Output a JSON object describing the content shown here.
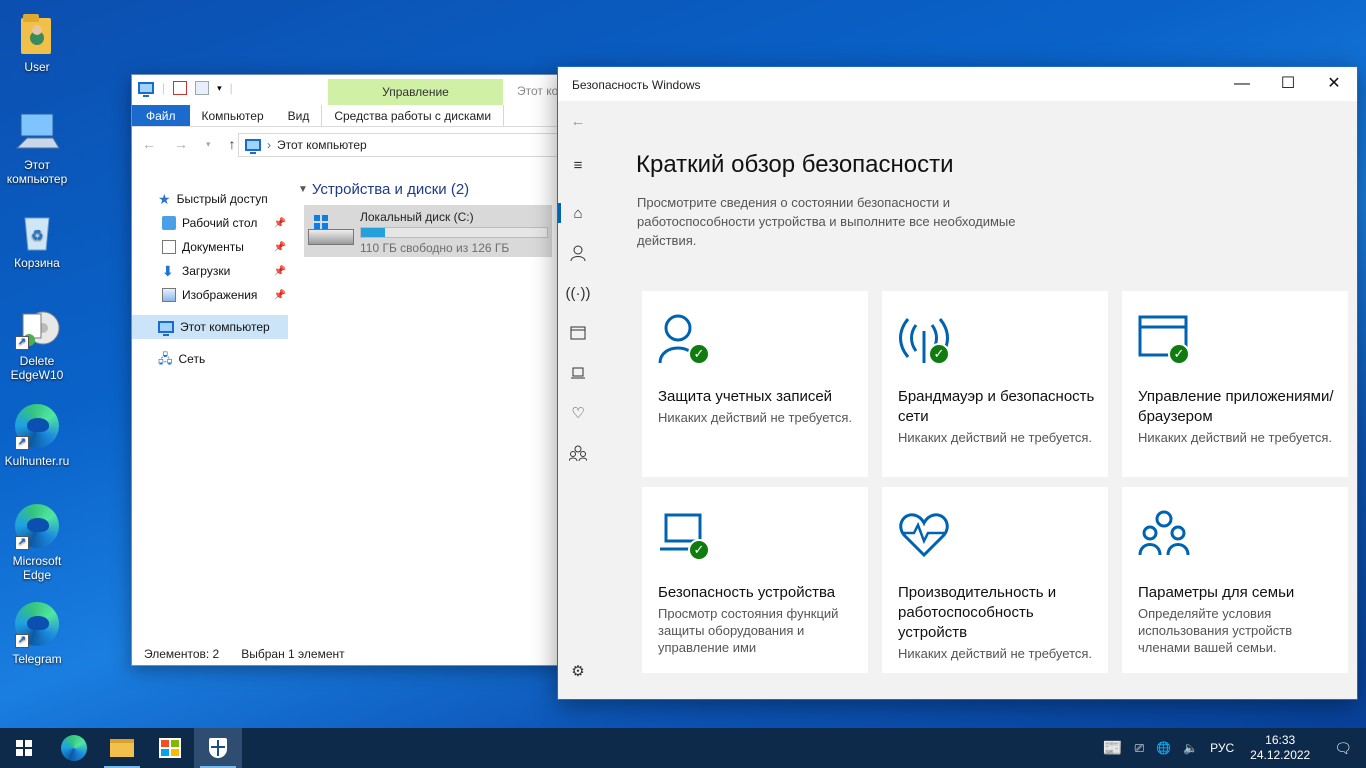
{
  "desktop": {
    "icons": [
      {
        "label": "User",
        "icon": "user-folder-icon"
      },
      {
        "label": "Этот компьютер",
        "icon": "computer-icon"
      },
      {
        "label": "Корзина",
        "icon": "recycle-bin-icon"
      },
      {
        "label": "Delete EdgeW10",
        "icon": "delete-edge-icon"
      },
      {
        "label": "Kulhunter.ru",
        "icon": "edge-icon"
      },
      {
        "label": "Microsoft Edge",
        "icon": "edge-icon"
      },
      {
        "label": "Telegram",
        "icon": "edge-icon"
      }
    ]
  },
  "explorer": {
    "ribbon_context_group": "Управление",
    "title_tail": "Этот ко",
    "tabs": [
      "Файл",
      "Компьютер",
      "Вид",
      "Средства работы с дисками"
    ],
    "address": "Этот компьютер",
    "sidebar": {
      "quick_access": "Быстрый доступ",
      "items": [
        {
          "label": "Рабочий стол",
          "icon": "desktop-folder-icon",
          "pinned": true
        },
        {
          "label": "Документы",
          "icon": "documents-icon",
          "pinned": true
        },
        {
          "label": "Загрузки",
          "icon": "downloads-icon",
          "pinned": true
        },
        {
          "label": "Изображения",
          "icon": "pictures-icon",
          "pinned": true
        }
      ],
      "this_pc": "Этот компьютер",
      "network": "Сеть"
    },
    "group_title": "Устройства и диски (2)",
    "drive": {
      "name": "Локальный диск (C:)",
      "free_text": "110 ГБ свободно из 126 ГБ",
      "used_fraction": 0.127
    },
    "status": {
      "items": "Элементов: 2",
      "selected": "Выбран 1 элемент"
    }
  },
  "security": {
    "title": "Безопасность Windows",
    "heading": "Краткий обзор безопасности",
    "description": "Просмотрите сведения о состоянии безопасности и работоспособности устройства и выполните все необходимые действия.",
    "tiles": [
      {
        "title": "Защита учетных записей",
        "sub": "Никаких действий не требуется.",
        "icon": "account-icon",
        "ok": true
      },
      {
        "title": "Брандмауэр и безопасность сети",
        "sub": "Никаких действий не требуется.",
        "icon": "firewall-icon",
        "ok": true
      },
      {
        "title": "Управление приложениями/браузером",
        "sub": "Никаких действий не требуется.",
        "icon": "app-browser-icon",
        "ok": true
      },
      {
        "title": "Безопасность устройства",
        "sub": "Просмотр состояния функций защиты оборудования и управление ими",
        "icon": "device-security-icon",
        "ok": true
      },
      {
        "title": "Производительность и работоспособность устройств",
        "sub": "Никаких действий не требуется.",
        "icon": "health-icon",
        "ok": false
      },
      {
        "title": "Параметры для семьи",
        "sub": "Определяйте условия использования устройств членами вашей семьи.",
        "icon": "family-icon",
        "ok": false
      }
    ],
    "accent": "#0063b1",
    "ok_color": "#107c10"
  },
  "taskbar": {
    "language": "РУС",
    "time": "16:33",
    "date": "24.12.2022"
  }
}
